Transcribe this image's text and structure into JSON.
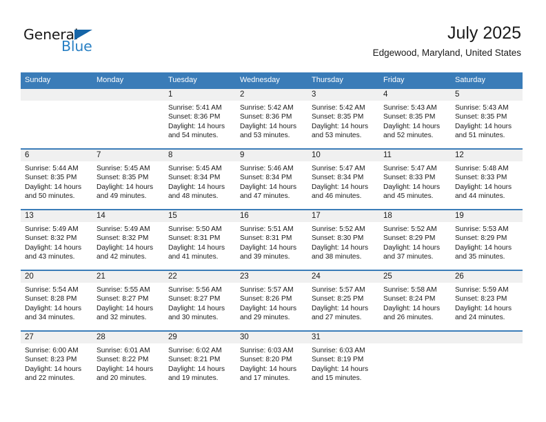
{
  "brand": {
    "name_part1": "General",
    "name_part2": "Blue",
    "triangle_icon": "triangle-icon",
    "accent_color": "#2980c4",
    "triangle_color": "#1565a8"
  },
  "header": {
    "month_title": "July 2025",
    "location": "Edgewood, Maryland, United States"
  },
  "theme": {
    "header_blue": "#3a7cb8",
    "daynum_band": "#f0f0f0",
    "text": "#1a1a1a"
  },
  "calendar": {
    "weekday_headers": [
      "Sunday",
      "Monday",
      "Tuesday",
      "Wednesday",
      "Thursday",
      "Friday",
      "Saturday"
    ],
    "weeks": [
      [
        {
          "day": "",
          "empty": true,
          "sunrise": "",
          "sunset": "",
          "daylight_line1": "",
          "daylight_line2": ""
        },
        {
          "day": "",
          "empty": true,
          "sunrise": "",
          "sunset": "",
          "daylight_line1": "",
          "daylight_line2": ""
        },
        {
          "day": "1",
          "empty": false,
          "sunrise": "Sunrise: 5:41 AM",
          "sunset": "Sunset: 8:36 PM",
          "daylight_line1": "Daylight: 14 hours",
          "daylight_line2": "and 54 minutes."
        },
        {
          "day": "2",
          "empty": false,
          "sunrise": "Sunrise: 5:42 AM",
          "sunset": "Sunset: 8:36 PM",
          "daylight_line1": "Daylight: 14 hours",
          "daylight_line2": "and 53 minutes."
        },
        {
          "day": "3",
          "empty": false,
          "sunrise": "Sunrise: 5:42 AM",
          "sunset": "Sunset: 8:35 PM",
          "daylight_line1": "Daylight: 14 hours",
          "daylight_line2": "and 53 minutes."
        },
        {
          "day": "4",
          "empty": false,
          "sunrise": "Sunrise: 5:43 AM",
          "sunset": "Sunset: 8:35 PM",
          "daylight_line1": "Daylight: 14 hours",
          "daylight_line2": "and 52 minutes."
        },
        {
          "day": "5",
          "empty": false,
          "sunrise": "Sunrise: 5:43 AM",
          "sunset": "Sunset: 8:35 PM",
          "daylight_line1": "Daylight: 14 hours",
          "daylight_line2": "and 51 minutes."
        }
      ],
      [
        {
          "day": "6",
          "empty": false,
          "sunrise": "Sunrise: 5:44 AM",
          "sunset": "Sunset: 8:35 PM",
          "daylight_line1": "Daylight: 14 hours",
          "daylight_line2": "and 50 minutes."
        },
        {
          "day": "7",
          "empty": false,
          "sunrise": "Sunrise: 5:45 AM",
          "sunset": "Sunset: 8:35 PM",
          "daylight_line1": "Daylight: 14 hours",
          "daylight_line2": "and 49 minutes."
        },
        {
          "day": "8",
          "empty": false,
          "sunrise": "Sunrise: 5:45 AM",
          "sunset": "Sunset: 8:34 PM",
          "daylight_line1": "Daylight: 14 hours",
          "daylight_line2": "and 48 minutes."
        },
        {
          "day": "9",
          "empty": false,
          "sunrise": "Sunrise: 5:46 AM",
          "sunset": "Sunset: 8:34 PM",
          "daylight_line1": "Daylight: 14 hours",
          "daylight_line2": "and 47 minutes."
        },
        {
          "day": "10",
          "empty": false,
          "sunrise": "Sunrise: 5:47 AM",
          "sunset": "Sunset: 8:34 PM",
          "daylight_line1": "Daylight: 14 hours",
          "daylight_line2": "and 46 minutes."
        },
        {
          "day": "11",
          "empty": false,
          "sunrise": "Sunrise: 5:47 AM",
          "sunset": "Sunset: 8:33 PM",
          "daylight_line1": "Daylight: 14 hours",
          "daylight_line2": "and 45 minutes."
        },
        {
          "day": "12",
          "empty": false,
          "sunrise": "Sunrise: 5:48 AM",
          "sunset": "Sunset: 8:33 PM",
          "daylight_line1": "Daylight: 14 hours",
          "daylight_line2": "and 44 minutes."
        }
      ],
      [
        {
          "day": "13",
          "empty": false,
          "sunrise": "Sunrise: 5:49 AM",
          "sunset": "Sunset: 8:32 PM",
          "daylight_line1": "Daylight: 14 hours",
          "daylight_line2": "and 43 minutes."
        },
        {
          "day": "14",
          "empty": false,
          "sunrise": "Sunrise: 5:49 AM",
          "sunset": "Sunset: 8:32 PM",
          "daylight_line1": "Daylight: 14 hours",
          "daylight_line2": "and 42 minutes."
        },
        {
          "day": "15",
          "empty": false,
          "sunrise": "Sunrise: 5:50 AM",
          "sunset": "Sunset: 8:31 PM",
          "daylight_line1": "Daylight: 14 hours",
          "daylight_line2": "and 41 minutes."
        },
        {
          "day": "16",
          "empty": false,
          "sunrise": "Sunrise: 5:51 AM",
          "sunset": "Sunset: 8:31 PM",
          "daylight_line1": "Daylight: 14 hours",
          "daylight_line2": "and 39 minutes."
        },
        {
          "day": "17",
          "empty": false,
          "sunrise": "Sunrise: 5:52 AM",
          "sunset": "Sunset: 8:30 PM",
          "daylight_line1": "Daylight: 14 hours",
          "daylight_line2": "and 38 minutes."
        },
        {
          "day": "18",
          "empty": false,
          "sunrise": "Sunrise: 5:52 AM",
          "sunset": "Sunset: 8:29 PM",
          "daylight_line1": "Daylight: 14 hours",
          "daylight_line2": "and 37 minutes."
        },
        {
          "day": "19",
          "empty": false,
          "sunrise": "Sunrise: 5:53 AM",
          "sunset": "Sunset: 8:29 PM",
          "daylight_line1": "Daylight: 14 hours",
          "daylight_line2": "and 35 minutes."
        }
      ],
      [
        {
          "day": "20",
          "empty": false,
          "sunrise": "Sunrise: 5:54 AM",
          "sunset": "Sunset: 8:28 PM",
          "daylight_line1": "Daylight: 14 hours",
          "daylight_line2": "and 34 minutes."
        },
        {
          "day": "21",
          "empty": false,
          "sunrise": "Sunrise: 5:55 AM",
          "sunset": "Sunset: 8:27 PM",
          "daylight_line1": "Daylight: 14 hours",
          "daylight_line2": "and 32 minutes."
        },
        {
          "day": "22",
          "empty": false,
          "sunrise": "Sunrise: 5:56 AM",
          "sunset": "Sunset: 8:27 PM",
          "daylight_line1": "Daylight: 14 hours",
          "daylight_line2": "and 30 minutes."
        },
        {
          "day": "23",
          "empty": false,
          "sunrise": "Sunrise: 5:57 AM",
          "sunset": "Sunset: 8:26 PM",
          "daylight_line1": "Daylight: 14 hours",
          "daylight_line2": "and 29 minutes."
        },
        {
          "day": "24",
          "empty": false,
          "sunrise": "Sunrise: 5:57 AM",
          "sunset": "Sunset: 8:25 PM",
          "daylight_line1": "Daylight: 14 hours",
          "daylight_line2": "and 27 minutes."
        },
        {
          "day": "25",
          "empty": false,
          "sunrise": "Sunrise: 5:58 AM",
          "sunset": "Sunset: 8:24 PM",
          "daylight_line1": "Daylight: 14 hours",
          "daylight_line2": "and 26 minutes."
        },
        {
          "day": "26",
          "empty": false,
          "sunrise": "Sunrise: 5:59 AM",
          "sunset": "Sunset: 8:23 PM",
          "daylight_line1": "Daylight: 14 hours",
          "daylight_line2": "and 24 minutes."
        }
      ],
      [
        {
          "day": "27",
          "empty": false,
          "sunrise": "Sunrise: 6:00 AM",
          "sunset": "Sunset: 8:23 PM",
          "daylight_line1": "Daylight: 14 hours",
          "daylight_line2": "and 22 minutes."
        },
        {
          "day": "28",
          "empty": false,
          "sunrise": "Sunrise: 6:01 AM",
          "sunset": "Sunset: 8:22 PM",
          "daylight_line1": "Daylight: 14 hours",
          "daylight_line2": "and 20 minutes."
        },
        {
          "day": "29",
          "empty": false,
          "sunrise": "Sunrise: 6:02 AM",
          "sunset": "Sunset: 8:21 PM",
          "daylight_line1": "Daylight: 14 hours",
          "daylight_line2": "and 19 minutes."
        },
        {
          "day": "30",
          "empty": false,
          "sunrise": "Sunrise: 6:03 AM",
          "sunset": "Sunset: 8:20 PM",
          "daylight_line1": "Daylight: 14 hours",
          "daylight_line2": "and 17 minutes."
        },
        {
          "day": "31",
          "empty": false,
          "sunrise": "Sunrise: 6:03 AM",
          "sunset": "Sunset: 8:19 PM",
          "daylight_line1": "Daylight: 14 hours",
          "daylight_line2": "and 15 minutes."
        },
        {
          "day": "",
          "empty": true,
          "sunrise": "",
          "sunset": "",
          "daylight_line1": "",
          "daylight_line2": ""
        },
        {
          "day": "",
          "empty": true,
          "sunrise": "",
          "sunset": "",
          "daylight_line1": "",
          "daylight_line2": ""
        }
      ]
    ]
  }
}
